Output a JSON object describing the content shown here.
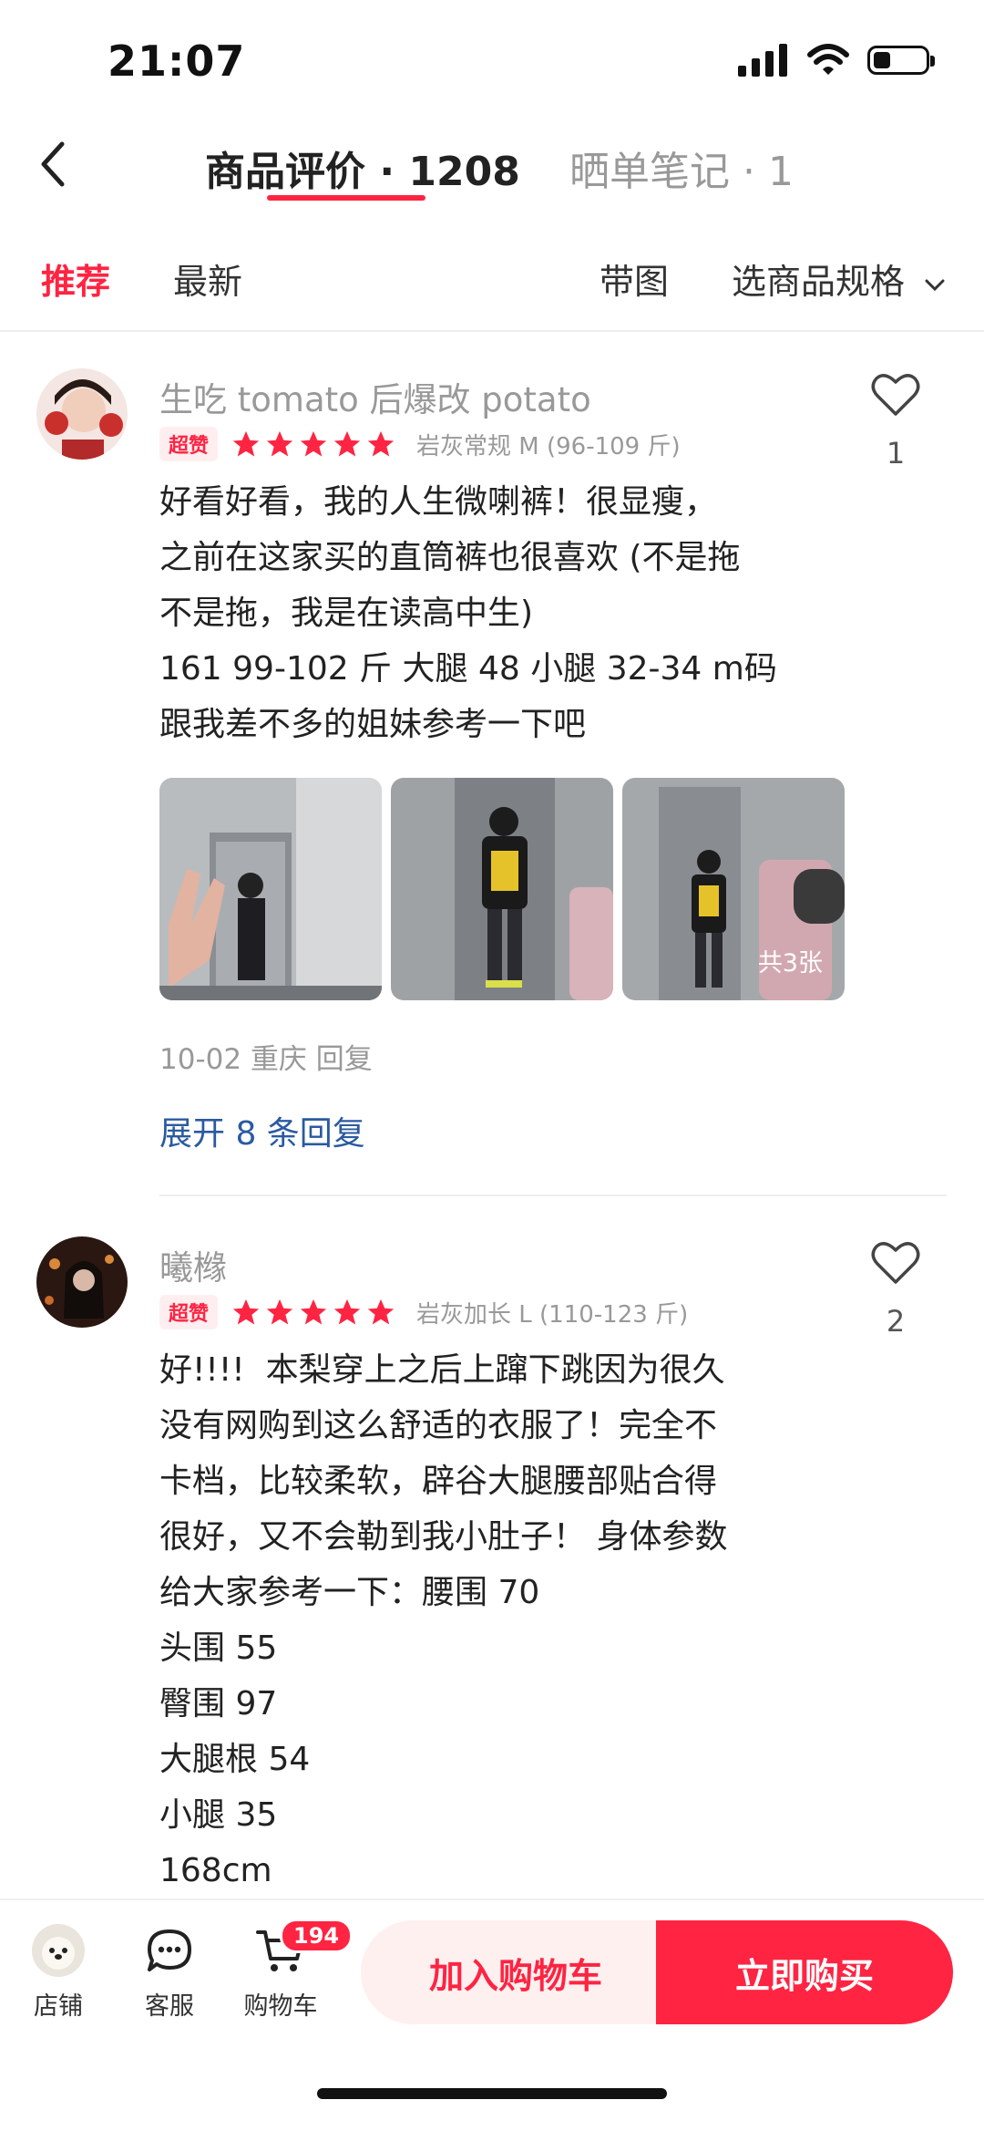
{
  "status_bar": {
    "time": "21:07"
  },
  "header": {
    "tab_reviews": "商品评价 · 1208",
    "tab_notes": "晒单笔记 · 1"
  },
  "filters": {
    "recommended": "推荐",
    "latest": "最新",
    "with_photos": "带图",
    "select_spec": "选商品规格"
  },
  "reviews": [
    {
      "user": "生吃 tomato 后爆改 potato",
      "badge": "超赞",
      "rating": 5,
      "spec": "岩灰常规  M (96-109 斤)",
      "text": "好看好看，我的人生微喇裤！很显瘦，\n之前在这家买的直筒裤也很喜欢 (不是拖\n不是拖，我是在读高中生)\n161 99-102 斤 大腿 48 小腿 32-34 m码\n跟我差不多的姐妹参考一下吧",
      "likes": "1",
      "photo_count_label": "共3张",
      "meta": "10-02 重庆 回复",
      "expand": "展开 8 条回复"
    },
    {
      "user": "曦橼",
      "badge": "超赞",
      "rating": 5,
      "spec": "岩灰加长  L (110-123 斤)",
      "text": "好!!!!  本梨穿上之后上蹿下跳因为很久\n没有网购到这么舒适的衣服了！完全不\n卡档，比较柔软，辟谷大腿腰部贴合得\n很好，又不会勒到我小肚子！ 身体参数\n给大家参考一下：腰围 70\n头围 55\n臀围 97\n大腿根 54\n小腿 35\n168cm",
      "likes": "2"
    }
  ],
  "bottom_bar": {
    "store": "店铺",
    "service": "客服",
    "cart": "购物车",
    "cart_count": "194",
    "add_to_cart": "加入购物车",
    "buy_now": "立即购买"
  },
  "colors": {
    "accent": "#ff2442",
    "link": "#2b5aa0"
  }
}
